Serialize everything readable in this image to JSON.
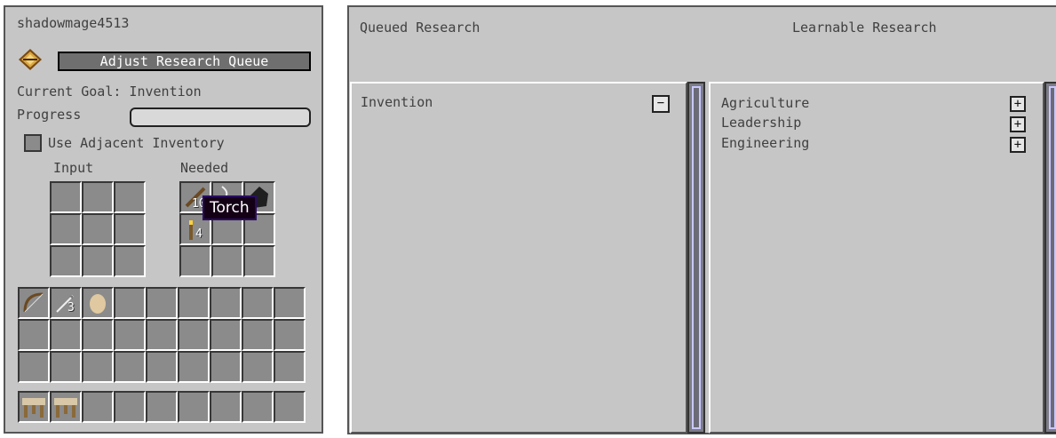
{
  "left_panel": {
    "player_name": "shadowmage4513",
    "adjust_button_label": "Adjust Research Queue",
    "current_goal": "Current Goal: Invention",
    "progress_label": "Progress",
    "progress_value": 0.0,
    "adjacent_label": "Use Adjacent Inventory",
    "input_label": "Input",
    "needed_label": "Needed",
    "needed_items": [
      {
        "icon": "stick-icon",
        "count": "10"
      },
      {
        "icon": "string-icon",
        "count": ""
      },
      {
        "icon": "coal-icon",
        "count": ""
      },
      {
        "icon": "torch-icon",
        "count": "4"
      }
    ],
    "tooltip_text": "Torch",
    "inventory_items": [
      {
        "icon": "bow-icon",
        "count": ""
      },
      {
        "icon": "arrow-icon",
        "count": "3"
      },
      {
        "icon": "egg-icon",
        "count": ""
      }
    ],
    "hotbar_items": [
      {
        "icon": "research-table-icon"
      },
      {
        "icon": "research-table-icon"
      }
    ]
  },
  "right_panel": {
    "queued_header": "Queued Research",
    "learnable_header": "Learnable Research",
    "queued_items": [
      {
        "label": "Invention",
        "action": "−"
      }
    ],
    "learnable_items": [
      {
        "label": "Agriculture",
        "action": "+"
      },
      {
        "label": "Leadership",
        "action": "+"
      },
      {
        "label": "Engineering",
        "action": "+"
      }
    ]
  },
  "colors": {
    "panel_bg": "#c6c6c6",
    "slot_bg": "#8b8b8b",
    "tooltip_bg": "#140015",
    "tooltip_border": "#2a0c63"
  }
}
